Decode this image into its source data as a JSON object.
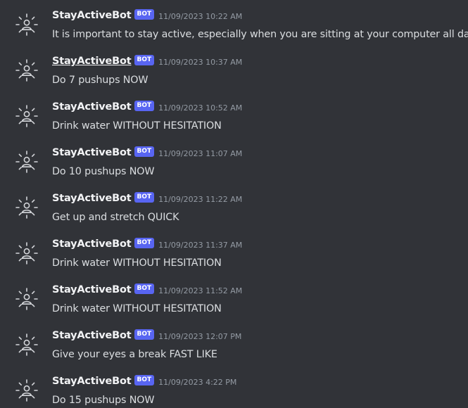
{
  "colors": {
    "background": "#313338",
    "username": "#f2f3f5",
    "message_text": "#dbdee1",
    "timestamp": "#949ba4",
    "bot_tag": "#5865f2"
  },
  "avatar_icon": "bot-avatar-icon",
  "messages": [
    {
      "author": "StayActiveBot",
      "tag": "BOT",
      "timestamp": "11/09/2023 10:22 AM",
      "text": "It is important to stay active, especially when you are sitting at your computer all day!"
    },
    {
      "author": "StayActiveBot",
      "tag": "BOT",
      "timestamp": "11/09/2023 10:37 AM",
      "text": "Do 7 pushups NOW"
    },
    {
      "author": "StayActiveBot",
      "tag": "BOT",
      "timestamp": "11/09/2023 10:52 AM",
      "text": "Drink water WITHOUT HESITATION"
    },
    {
      "author": "StayActiveBot",
      "tag": "BOT",
      "timestamp": "11/09/2023 11:07 AM",
      "text": "Do 10 pushups NOW"
    },
    {
      "author": "StayActiveBot",
      "tag": "BOT",
      "timestamp": "11/09/2023 11:22 AM",
      "text": "Get up and stretch QUICK"
    },
    {
      "author": "StayActiveBot",
      "tag": "BOT",
      "timestamp": "11/09/2023 11:37 AM",
      "text": "Drink water WITHOUT HESITATION"
    },
    {
      "author": "StayActiveBot",
      "tag": "BOT",
      "timestamp": "11/09/2023 11:52 AM",
      "text": "Drink water WITHOUT HESITATION"
    },
    {
      "author": "StayActiveBot",
      "tag": "BOT",
      "timestamp": "11/09/2023 12:07 PM",
      "text": "Give your eyes a break FAST LIKE"
    },
    {
      "author": "StayActiveBot",
      "tag": "BOT",
      "timestamp": "11/09/2023 4:22 PM",
      "text": "Do 15 pushups NOW"
    }
  ]
}
